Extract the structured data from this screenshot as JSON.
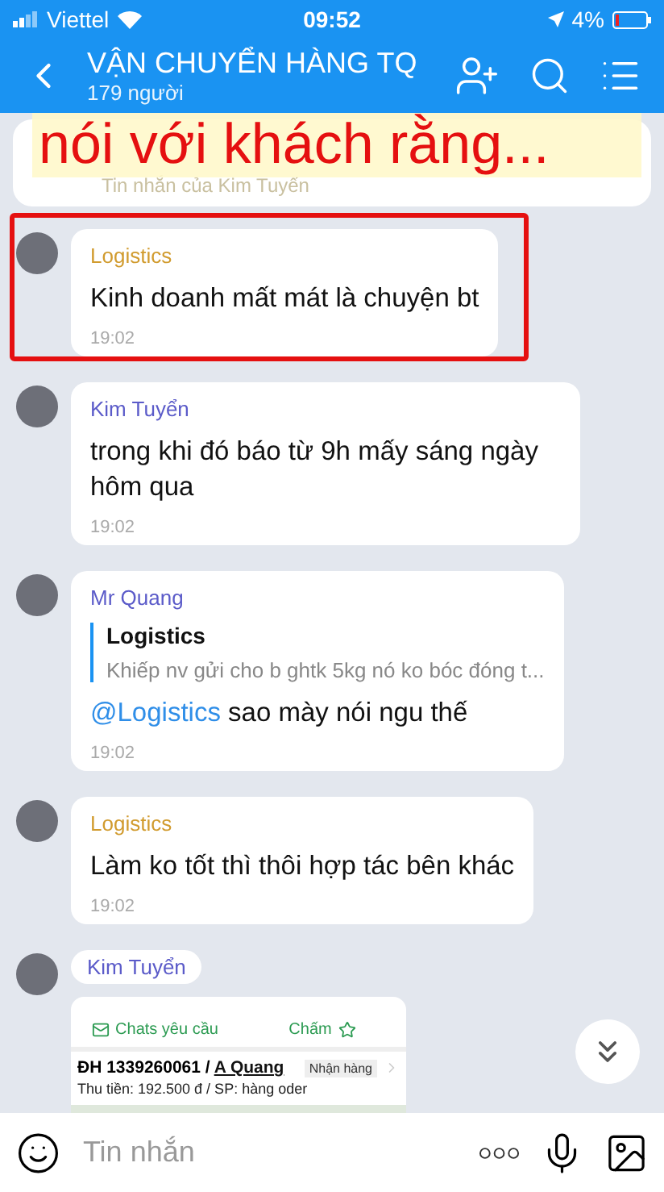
{
  "status_bar": {
    "carrier": "Viettel",
    "time": "09:52",
    "battery": "4%"
  },
  "header": {
    "title": "VẬN CHUYỂN HÀNG TQ",
    "subtitle": "179 người"
  },
  "pinned": {
    "subtitle": "Tin nhắn của Kim Tuyến"
  },
  "annotation": {
    "text": "nói với khách rằng..."
  },
  "messages": [
    {
      "kind": "text",
      "sender": "Logistics",
      "color": "#d19b2e",
      "text": "Kinh doanh mất mát là chuyện bt",
      "time": "19:02",
      "highlighted": true
    },
    {
      "kind": "text",
      "sender": "Kim Tuyển",
      "color": "#5b5bc9",
      "text": "trong khi đó báo từ 9h mấy sáng ngày hôm qua",
      "time": "19:02",
      "highlighted": false
    },
    {
      "kind": "reply",
      "sender": "Mr Quang",
      "color": "#5b5bc9",
      "quote": {
        "author": "Logistics",
        "text": "Khiếp nv gửi cho b ghtk 5kg nó ko bóc đóng t..."
      },
      "mention": "@Logistics",
      "text": "sao mày nói ngu thế",
      "time": "19:02",
      "highlighted": false
    },
    {
      "kind": "text",
      "sender": "Logistics",
      "color": "#d19b2e",
      "text": "Làm ko tốt thì thôi hợp tác bên khác",
      "time": "19:02",
      "highlighted": false
    },
    {
      "kind": "order_card",
      "sender": "Kim Tuyển",
      "color": "#5b5bc9",
      "actions": [
        "Chats yêu cầu",
        "Chấm"
      ],
      "order": "ĐH 1339260061 / ",
      "customer": "A Quang",
      "status": "Nhận hàng",
      "detail": "Thu tiền: 192.500 đ / SP: hàng oder",
      "highlighted": false
    }
  ],
  "composer": {
    "placeholder": "Tin nhắn"
  }
}
